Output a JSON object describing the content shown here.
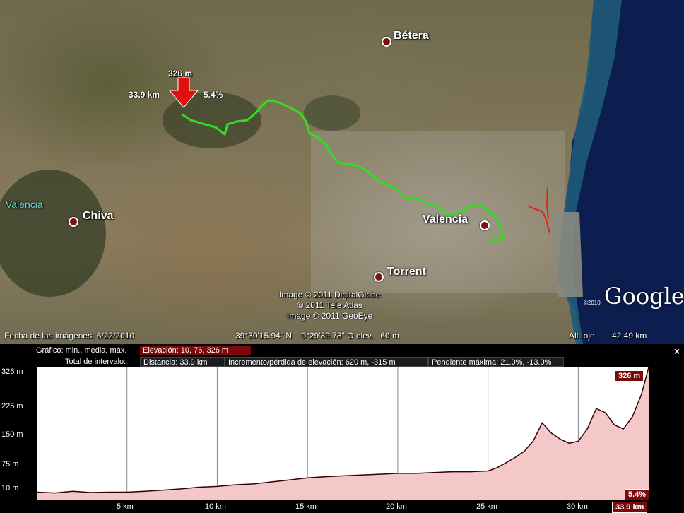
{
  "map": {
    "cities": [
      {
        "id": "betera",
        "name": "Bétera"
      },
      {
        "id": "chiva",
        "name": "Chiva"
      },
      {
        "id": "valencia",
        "name": "Valencia"
      },
      {
        "id": "torrent",
        "name": "Torrent"
      }
    ],
    "province_label": "Valencia",
    "marker": {
      "elevation": "326 m",
      "distance": "33.9 km",
      "slope": "5.4%"
    },
    "credits": [
      "Image © 2011 DigitalGlobe",
      "© 2011 Tele Atlas",
      "Image © 2011 GeoEye"
    ],
    "google_logo": "Google",
    "google_year": "©2010",
    "imagery_date": "Fecha de las imágenes: 6/22/2010",
    "coordinates": "39°30'15.94\" N    0°29'39.78\" O elev.   60 m",
    "eye_alt_label": "Alt. ojo",
    "eye_alt_value": "42.49 km",
    "route_color": "#33dd22",
    "secondary_route_color": "#dd2222"
  },
  "profile": {
    "graph_label": "Gráfico: min., media, máx.",
    "elevation_summary": "Elevación: 10, 76, 326 m",
    "interval_label": "Total de intervalo:",
    "distance": "Distancia: 33.9 km",
    "gain_loss": "Incremento/pérdida de elevación: 620 m, -315 m",
    "max_slope": "Pendiente máxima: 21.0%, -13.0%",
    "close_label": "×",
    "y_ticks": [
      "326 m",
      "225 m",
      "150 m",
      "75 m",
      "10 m"
    ],
    "x_ticks": [
      "5 km",
      "10 km",
      "15 km",
      "20 km",
      "25 km",
      "30 km"
    ],
    "cursor_elevation": "326 m",
    "cursor_distance": "33.9 km",
    "cursor_slope": "5.4%"
  },
  "chart_data": {
    "type": "area",
    "x": [
      0,
      1,
      2,
      3,
      4,
      5,
      6,
      7,
      8,
      9,
      10,
      11,
      12,
      13,
      14,
      15,
      16,
      17,
      18,
      19,
      20,
      21,
      22,
      23,
      24,
      25,
      25.5,
      26,
      26.5,
      27,
      27.5,
      28,
      28.5,
      29,
      29.5,
      30,
      30.5,
      31,
      31.5,
      32,
      32.5,
      33,
      33.5,
      33.9
    ],
    "series": [
      {
        "values": [
          20,
          18,
          22,
          19,
          20,
          20,
          22,
          25,
          28,
          32,
          34,
          38,
          40,
          45,
          50,
          55,
          58,
          60,
          62,
          64,
          66,
          66,
          68,
          70,
          70,
          72,
          80,
          92,
          105,
          120,
          145,
          190,
          165,
          150,
          140,
          145,
          175,
          225,
          215,
          185,
          175,
          205,
          260,
          326
        ]
      }
    ],
    "xlim": [
      0,
      33.9
    ],
    "ylim": [
      0,
      326
    ],
    "y_axis_ticks": [
      10,
      75,
      150,
      225,
      326
    ],
    "x_axis_ticks": [
      5,
      10,
      15,
      20,
      25,
      30
    ],
    "fill_color": "#f4c8c8",
    "line_color": "#330000",
    "grid": true
  }
}
